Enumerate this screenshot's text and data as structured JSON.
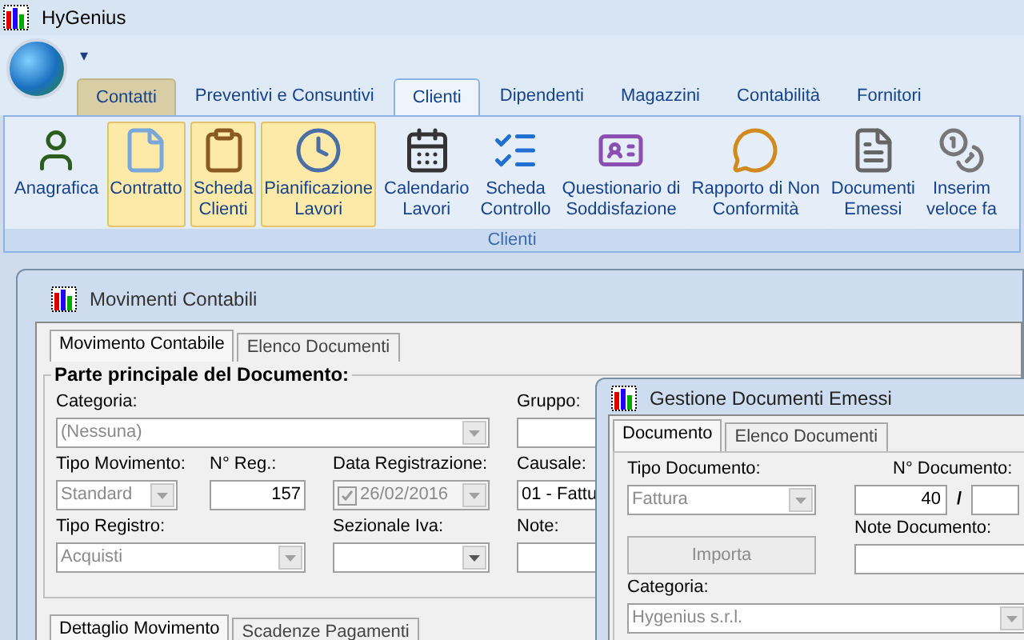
{
  "window": {
    "title": "HyGenius"
  },
  "quick_access": {
    "symbol": "▾"
  },
  "tabs": [
    {
      "label": "Contatti",
      "selected": false,
      "highlighted": true
    },
    {
      "label": "Preventivi e Consuntivi",
      "selected": false,
      "highlighted": false
    },
    {
      "label": "Clienti",
      "selected": true,
      "highlighted": false
    },
    {
      "label": "Dipendenti",
      "selected": false,
      "highlighted": false
    },
    {
      "label": "Magazzini",
      "selected": false,
      "highlighted": false
    },
    {
      "label": "Contabilità",
      "selected": false,
      "highlighted": false
    },
    {
      "label": "Fornitori",
      "selected": false,
      "highlighted": false
    }
  ],
  "ribbon": {
    "group": "Clienti",
    "items": [
      {
        "label": "Anagrafica",
        "highlighted": false
      },
      {
        "label": "Contratto",
        "highlighted": true
      },
      {
        "label": "Scheda\nClienti",
        "highlighted": true
      },
      {
        "label": "Pianificazione\nLavori",
        "highlighted": true
      },
      {
        "label": "Calendario\nLavori",
        "highlighted": false
      },
      {
        "label": "Scheda\nControllo",
        "highlighted": false
      },
      {
        "label": "Questionario di\nSoddisfazione",
        "highlighted": false
      },
      {
        "label": "Rapporto di Non\nConformità",
        "highlighted": false
      },
      {
        "label": "Documenti\nEmessi",
        "highlighted": false
      },
      {
        "label": "Inserim\nveloce fa",
        "highlighted": false
      }
    ]
  },
  "main_window": {
    "title": "Movimenti Contabili",
    "tabs": [
      {
        "label": "Movimento Contabile",
        "selected": true
      },
      {
        "label": "Elenco Documenti",
        "selected": false
      }
    ],
    "group_title": "Parte principale del Documento:",
    "fields": [
      {
        "label": "Categoria:",
        "kind": "combo",
        "value": "(Nessuna)",
        "disabled": true
      },
      {
        "label": "Gruppo:",
        "kind": "text"
      },
      {
        "label": "Tipo Movimento:",
        "kind": "combo",
        "value": "Standard",
        "disabled": true
      },
      {
        "label": "N° Reg.:",
        "kind": "number",
        "value": "157"
      },
      {
        "label": "Data Registrazione:",
        "kind": "date",
        "value": "26/02/2016",
        "disabled": true,
        "checked": true
      },
      {
        "label": "Causale:",
        "kind": "text",
        "value": "01 - Fattu"
      },
      {
        "label": "Tipo Registro:",
        "kind": "combo",
        "value": "Acquisti",
        "disabled": true
      },
      {
        "label": "Sezionale Iva:",
        "kind": "combo",
        "disabled": false
      },
      {
        "label": "Note:",
        "kind": "text"
      }
    ],
    "sub_tabs": [
      {
        "label": "Dettaglio Movimento",
        "selected": true
      },
      {
        "label": "Scadenze Pagamenti",
        "selected": false
      }
    ]
  },
  "dialog": {
    "title": "Gestione Documenti Emessi",
    "tabs": [
      {
        "label": "Documento",
        "selected": true
      },
      {
        "label": "Elenco Documenti",
        "selected": false
      }
    ],
    "tipo_documento": {
      "label": "Tipo Documento:",
      "value": "Fattura",
      "disabled": true
    },
    "numero": {
      "label": "N° Documento:",
      "value": "40",
      "separator": "/"
    },
    "import_button": {
      "label": "Importa",
      "disabled": true
    },
    "note": {
      "label": "Note Documento:"
    },
    "categoria": {
      "label": "Categoria:",
      "value": "Hygenius s.r.l.",
      "disabled": true
    }
  }
}
